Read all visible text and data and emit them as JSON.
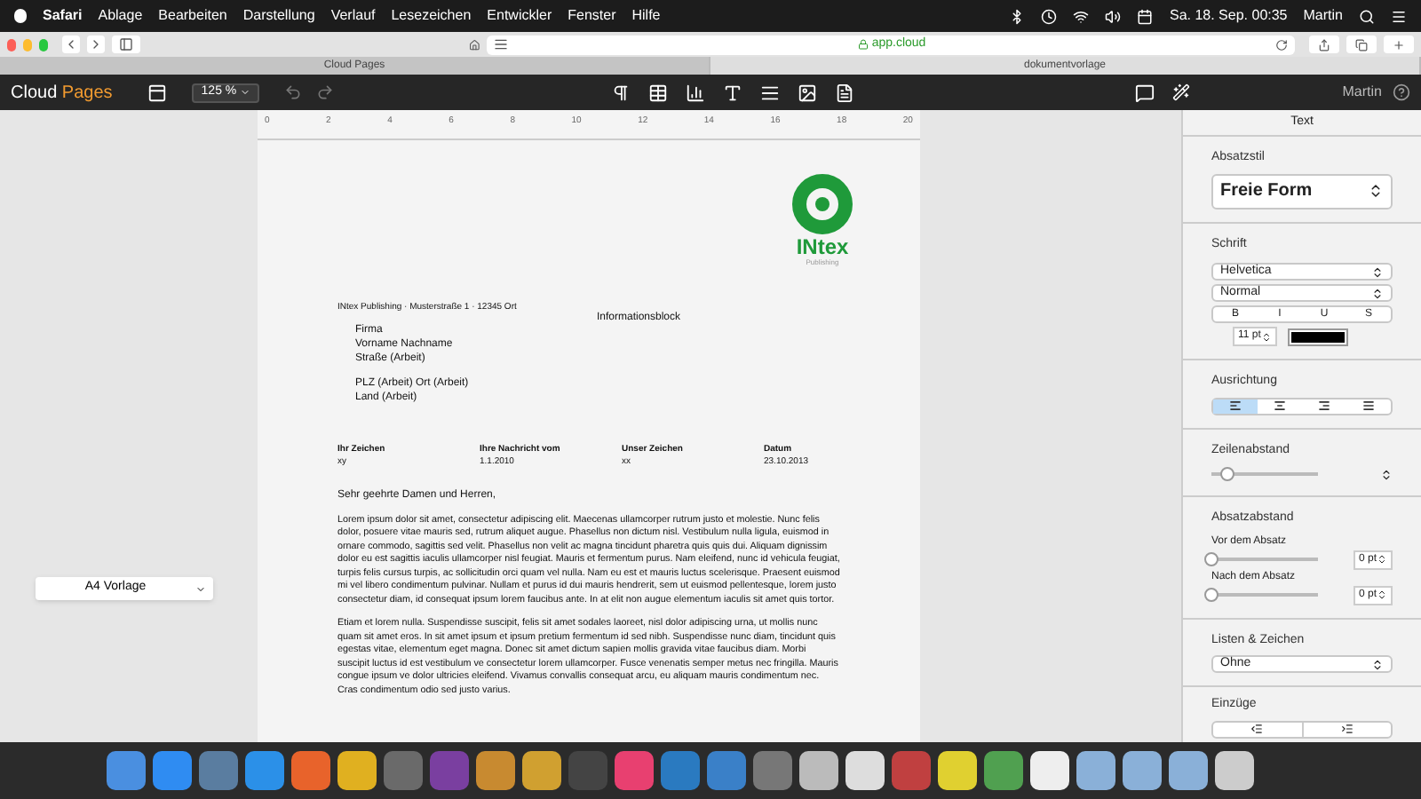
{
  "menu_bar": {
    "items": [
      "Safari",
      "Ablage",
      "Bearbeiten",
      "Darstellung",
      "Verlauf",
      "Lesezeichen",
      "Entwickler",
      "Fenster",
      "Hilfe"
    ],
    "clock": "Sa. 18. Sep. 00:35",
    "user": "Martin"
  },
  "browser": {
    "address": "app.cloud",
    "tabs": [
      {
        "label": "Cloud Pages",
        "selected": false
      },
      {
        "label": "dokumentvorlage",
        "selected": true
      }
    ]
  },
  "app_toolbar": {
    "brand_first": "Cloud",
    "brand_second": "Pages",
    "zoom": "125 %",
    "user": "Martin"
  },
  "template_select": {
    "value": "A4 Vorlage"
  },
  "ruler": {
    "labels": [
      "0",
      "2",
      "4",
      "6",
      "8",
      "10",
      "12",
      "14",
      "16",
      "18",
      "20"
    ]
  },
  "document": {
    "logo_text": "INtex",
    "logo_subtext": "Publishing",
    "sender_line": "INtex Publishing · Musterstraße 1 · 12345 Ort",
    "address": [
      "Firma",
      "Vorname Nachname",
      "Straße (Arbeit)"
    ],
    "address_2": [
      "PLZ (Arbeit) Ort (Arbeit)",
      "Land (Arbeit)"
    ],
    "info_block": "Informationsblock",
    "reference_fields": [
      {
        "label": "Ihr Zeichen",
        "value": "xy"
      },
      {
        "label": "Ihre Nachricht vom",
        "value": "1.1.2010"
      },
      {
        "label": "Unser Zeichen",
        "value": "xx"
      },
      {
        "label": "Datum",
        "value": "23.10.2013"
      }
    ],
    "salutation": "Sehr geehrte Damen und Herren,",
    "paragraphs": [
      "Lorem ipsum dolor sit amet, consectetur adipiscing elit. Maecenas ullamcorper rutrum justo et molestie. Nunc felis dolor, posuere vitae mauris sed, rutrum aliquet augue. Phasellus non dictum nisl. Vestibulum nulla ligula, euismod in ornare commodo, sagittis sed velit. Phasellus non velit ac magna tincidunt pharetra quis quis dui. Aliquam dignissim dolor eu est sagittis iaculis ullamcorper nisl feugiat. Mauris et fermentum purus. Nam eleifend, nunc id vehicula feugiat, turpis felis cursus turpis, ac sollicitudin orci quam vel nulla. Nam eu est et mauris luctus scelerisque. Praesent euismod mi vel libero condimentum pulvinar. Nullam et purus id dui mauris hendrerit, sem ut euismod pellentesque, lorem justo consectetur diam, id consequat ipsum lorem faucibus ante. In at elit non augue elementum iaculis sit amet quis tortor.",
      "Etiam et lorem nulla. Suspendisse suscipit, felis sit amet sodales laoreet, nisl dolor adipiscing urna, ut mollis nunc quam sit amet eros. In sit amet ipsum et ipsum pretium fermentum id sed nibh. Suspendisse nunc diam, tincidunt quis egestas vitae, elementum eget magna. Donec sit amet dictum sapien mollis gravida vitae faucibus diam. Morbi suscipit luctus id est vestibulum ve consectetur lorem ullamcorper. Fusce venenatis semper metus nec fringilla. Mauris congue ipsum ve dolor ultricies eleifend. Vivamus convallis consequat arcu, eu aliquam mauris condimentum nec. Cras condimentum odio sed justo varius."
    ]
  },
  "inspector": {
    "title": "Text",
    "paragraph_style": {
      "label": "Absatzstil",
      "value": "Freie Form"
    },
    "font": {
      "label": "Schrift",
      "family": "Helvetica",
      "typeface": "Normal",
      "styles": [
        {
          "label": "B",
          "selected": false
        },
        {
          "label": "I",
          "selected": false
        },
        {
          "label": "U",
          "selected": false
        },
        {
          "label": "S",
          "selected": false
        }
      ],
      "size": "11 pt",
      "color": "#000000"
    },
    "alignment": {
      "label": "Ausrichtung",
      "options": [
        {
          "kind": "left",
          "selected": true
        },
        {
          "kind": "center",
          "selected": false
        },
        {
          "kind": "right",
          "selected": false
        },
        {
          "kind": "justify",
          "selected": false
        }
      ]
    },
    "line_spacing": {
      "label": "Zeilenabstand",
      "level": 0.15
    },
    "paragraph_spacing": {
      "label": "Absatzabstand",
      "rows": [
        {
          "label": "Vor dem Absatz",
          "level": 0,
          "value": "0 pt"
        },
        {
          "label": "Nach dem Absatz",
          "level": 0,
          "value": "0 pt"
        }
      ]
    },
    "lists": {
      "label": "Listen & Zeichen",
      "value": "Ohne"
    },
    "indents": {
      "label": "Einzüge"
    }
  }
}
